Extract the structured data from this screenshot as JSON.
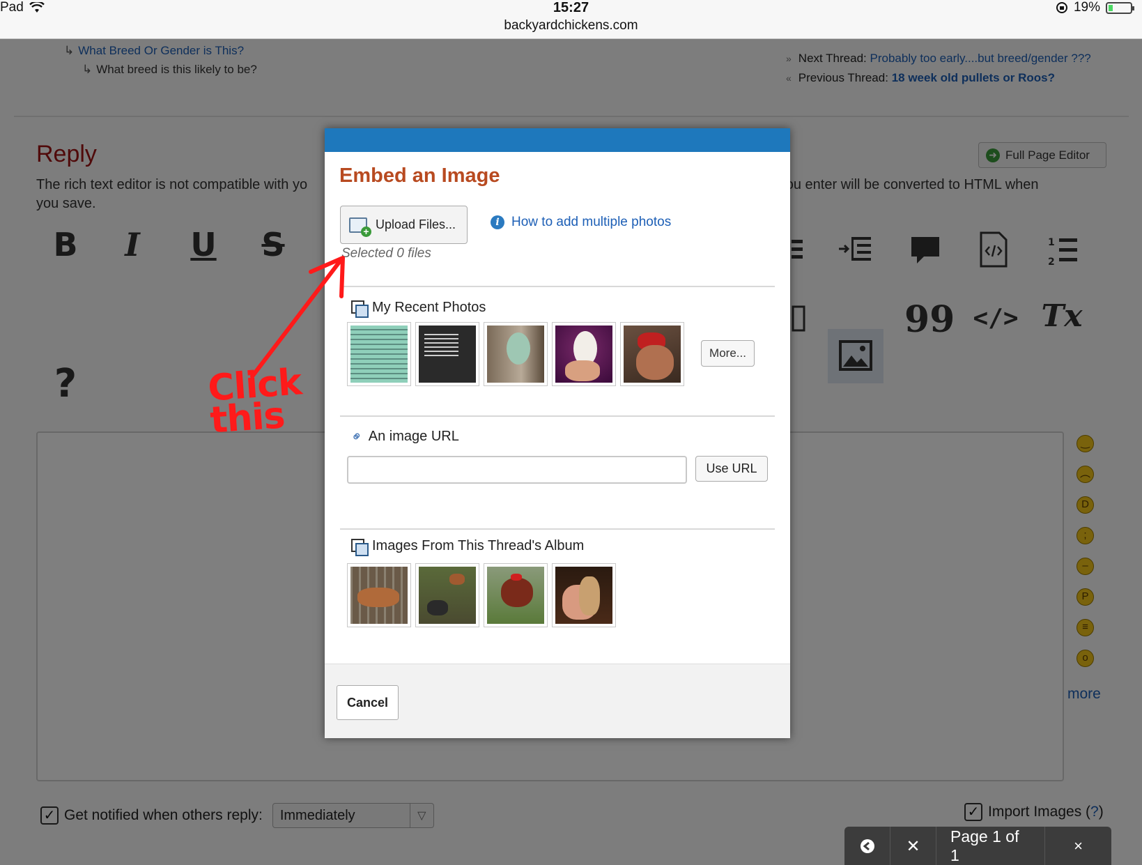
{
  "status_bar": {
    "device": "Pad",
    "time": "15:27",
    "url": "backyardchickens.com",
    "battery": "19%"
  },
  "breadcrumbs": {
    "forum_link": "What Breed Or Gender is This?",
    "current": "What breed is this likely to be?"
  },
  "thread_nav": {
    "next_label": "Next Thread:",
    "next_link": "Probably too early....but breed/gender ???",
    "prev_label": "Previous Thread:",
    "prev_link": "18 week old pullets or Roos?"
  },
  "reply": {
    "title": "Reply",
    "full_page_editor": "Full Page Editor",
    "note_left": "The rich text editor is not compatible with yo",
    "note_right": "e you enter will be converted to HTML when",
    "note_line2": "you save."
  },
  "toolbar_glyphs": {
    "bold": "B",
    "italic": "I",
    "underline": "U",
    "strike": "S",
    "help": "?",
    "quote": "99",
    "code": "</>",
    "clear": "Tx"
  },
  "smilies_more": "more",
  "footer_controls": {
    "notify_label": "Get notified when others reply:",
    "notify_value": "Immediately",
    "import_label": "Import Images (",
    "import_q": "?",
    "import_close": ")"
  },
  "modal": {
    "title": "Embed an Image",
    "upload_button": "Upload Files...",
    "howto_link": "How to add multiple photos",
    "selected_text": "Selected 0 files",
    "recent_heading": "My Recent Photos",
    "more_button": "More...",
    "url_heading": "An image URL",
    "url_value": "",
    "use_url_button": "Use URL",
    "album_heading": "Images From This Thread's Album",
    "cancel_button": "Cancel",
    "recent_thumbs": [
      "quote-text-teal",
      "quote-text-dark",
      "green-egg",
      "white-egg",
      "red-hen"
    ],
    "album_thumbs": [
      "hens-in-coop",
      "chickens-in-yard",
      "rooster-on-grass",
      "chick-in-hand"
    ]
  },
  "page_control": {
    "page_text": "Page 1 of 1"
  },
  "annotation": {
    "line1": "Click",
    "line2": "this",
    "color": "#ff1a1a"
  },
  "colors": {
    "modal_bar": "#1e78bc",
    "modal_title": "#b84a20",
    "link": "#1d5fb6",
    "reply_title": "#a01414"
  }
}
